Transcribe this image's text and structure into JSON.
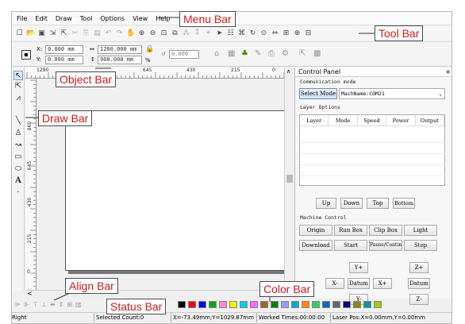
{
  "menu": {
    "items": [
      "File",
      "Edit",
      "Draw",
      "Tool",
      "Options",
      "View",
      "Help"
    ]
  },
  "objbar": {
    "x_label": "X:",
    "x_value": "0.000 mm",
    "y_label": "Y:",
    "y_value": "0.000 mm",
    "w_value": "1200.000 mm",
    "h_value": "900.000 mm",
    "pct": "%",
    "angle_value": "0.000"
  },
  "ruler": {
    "top_ticks": [
      "1290",
      "645",
      "430",
      "215",
      "0"
    ],
    "left_ticks": [
      "860",
      "645",
      "430",
      "215",
      "0"
    ]
  },
  "control_panel": {
    "title": "Control Panel",
    "comm_label": "Communication mode",
    "select_mode": "Select Mode",
    "machine_name": "MachName:COM21",
    "layer_label": "Layer Options",
    "layer_cols": [
      "Layer",
      "Mode",
      "Speed",
      "Power",
      "Output"
    ],
    "layer_buttons": [
      "Up",
      "Down",
      "Top",
      "Bottom"
    ],
    "machine_label": "Machine Control",
    "machine_row1": [
      "Origin",
      "Run Box",
      "Clip Box",
      "Light"
    ],
    "machine_row2": [
      "Download",
      "Start",
      "Pause/Continue",
      "Stop"
    ],
    "axis": {
      "yplus": "Y+",
      "yminus": "Y-",
      "xminus": "X-",
      "xplus": "X+",
      "datum": "Datum",
      "zplus": "Z+",
      "zminus": "Z-",
      "zdatum": "Datum"
    }
  },
  "colorbar": {
    "colors": [
      "#000000",
      "#ff0000",
      "#0000ff",
      "#00aa00",
      "#ff88cc",
      "#ffee00",
      "#00ccff",
      "#ff66ff",
      "#996633",
      "#008000",
      "#9999ff",
      "#00aacc",
      "#ff8800",
      "#33cc66",
      "#0066cc",
      "#666666",
      "#000088",
      "#888800",
      "#009999",
      "#99cc00"
    ]
  },
  "status": {
    "mode": "Right",
    "selected": "Selected Count:0",
    "xy": "X=-73.49mm;Y=1029.87mm",
    "worked": "Worked Times:00:00:00",
    "laser": "Laser Pos:X=0.00mm,Y=0.00mm"
  },
  "callouts": {
    "menu": "Menu Bar",
    "tool": "Tool Bar",
    "object": "Object Bar",
    "draw": "Draw Bar",
    "align": "Align Bar",
    "color": "Color Bar",
    "status": "Status Bar"
  }
}
